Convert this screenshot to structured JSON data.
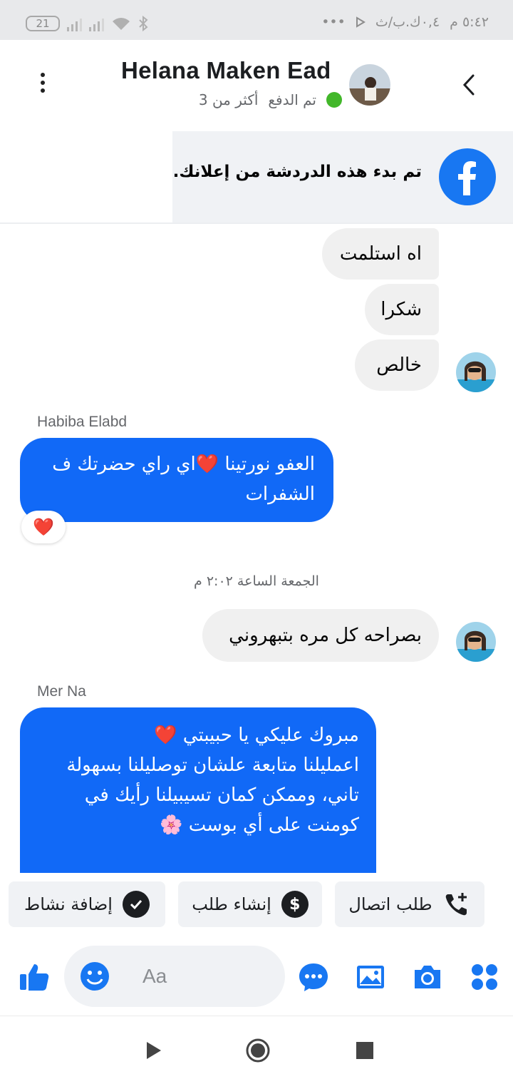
{
  "status_bar": {
    "battery": "21",
    "time": "٥:٤٢ م",
    "carrier": "٠,٤ك.ب/ث",
    "dots": "•••"
  },
  "header": {
    "title": "Helana Maken Ead",
    "paid_status": "تم الدفع",
    "more_than": "أكثر من 3"
  },
  "ad_banner": {
    "text": "تم بدء هذه الدردشة من إعلانك."
  },
  "messages": {
    "in1": "اه استلمت",
    "in2": "شكرا",
    "in3": "خالص",
    "sender1": "Habiba Elabd",
    "out1_line1": "العفو نورتينا ❤️اي راي حضرتك ف",
    "out1_line2": "الشفرات",
    "reaction": "❤️",
    "timestamp": "الجمعة الساعة ٢:٠٢ م",
    "in4": "بصراحه كل مره بتبهروني",
    "sender2": "Mer Na",
    "out2_line1": "مبروك عليكي يا حبيبتي ❤️",
    "out2_line2": "اعمليلنا متابعة علشان توصليلنا بسهولة",
    "out2_line3": "تاني، وممكن كمان تسيبيلنا رأيك في",
    "out2_line4": "كومنت على أي بوست 🌸"
  },
  "quick_actions": {
    "call": "طلب اتصال",
    "order": "إنشاء طلب",
    "activity": "إضافة نشاط"
  },
  "composer": {
    "placeholder": "Aa"
  },
  "colors": {
    "accent": "#1877f2",
    "bubble_out": "#1169f7",
    "bubble_in": "#f0f0f0"
  }
}
